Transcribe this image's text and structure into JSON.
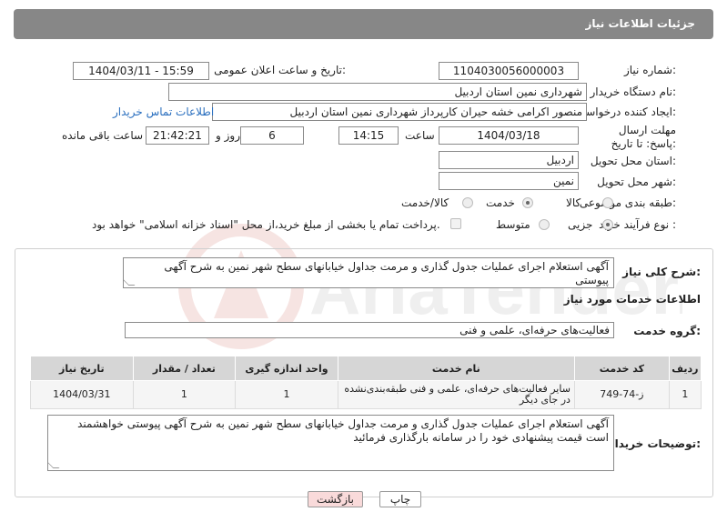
{
  "header": {
    "title": "جزئیات اطلاعات نیاز"
  },
  "labels": {
    "need_number": "شماره نیاز:",
    "announce_datetime": "تاریخ و ساعت اعلان عمومی:",
    "buyer_org": "نام دستگاه خریدار:",
    "requester": "ایجاد کننده درخواست:",
    "deadline": "مهلت ارسال پاسخ: تا تاریخ:",
    "time": "ساعت",
    "days_and": "روز و",
    "time_remaining": "ساعت باقی مانده",
    "province": "استان محل تحویل:",
    "city": "شهر محل تحویل:",
    "category": "طبقه بندی موضوعی:",
    "process_type": "نوع فرآیند خرید :",
    "general_desc": "شرح کلی نیاز:",
    "services_info": "اطلاعات خدمات مورد نیاز",
    "service_group": "گروه خدمت:",
    "buyer_notes": "توضیحات خریدار:"
  },
  "fields": {
    "need_number": "1104030056000003",
    "announce_datetime": "1404/03/11 - 15:59",
    "buyer_org": "شهرداری نمین استان اردبیل",
    "requester": "منصور اکرامی خشه حیران کارپرداز شهرداری نمین استان اردبیل",
    "contact_link": "اطلاعات تماس خریدار",
    "deadline_date": "1404/03/18",
    "deadline_time": "14:15",
    "days": "6",
    "remaining": "21:42:21",
    "province": "اردبیل",
    "city": "نمین"
  },
  "category_options": [
    {
      "label": "کالا",
      "selected": false
    },
    {
      "label": "خدمت",
      "selected": true
    },
    {
      "label": "کالا/خدمت",
      "selected": false
    }
  ],
  "process_options": [
    {
      "label": "جزیی",
      "selected": true
    },
    {
      "label": "متوسط",
      "selected": false
    }
  ],
  "payment_note": "پرداخت تمام یا بخشی از مبلغ خرید،از محل \"اسناد خزانه اسلامی\" خواهد بود.",
  "general_desc": "آگهی استعلام اجرای عملیات جدول گذاری و مرمت جداول خیابانهای سطح شهر نمین به شرح آگهی پیوستی",
  "service_group": "فعالیت‌های حرفه‌ای، علمی و فنی",
  "table": {
    "headers": [
      "ردیف",
      "کد خدمت",
      "نام خدمت",
      "واحد اندازه گیری",
      "تعداد / مقدار",
      "تاریخ نیاز"
    ],
    "rows": [
      [
        "1",
        "ز-74-749",
        "سایر فعالیت‌های حرفه‌ای، علمی و فنی طبقه‌بندی‌نشده در جای دیگر",
        "1",
        "1",
        "1404/03/31"
      ]
    ]
  },
  "buyer_notes": "آگهی استعلام اجرای عملیات جدول گذاری و مرمت جداول خیابانهای سطح شهر نمین به شرح آگهی پیوستی خواهشمند است قیمت پیشنهادی خود را در سامانه بارگذاری فرمائید",
  "buttons": {
    "print": "چاپ",
    "back": "بازگشت"
  },
  "watermark": {
    "text": "AriaTender.neT"
  },
  "colors": {
    "header_bg": "#878787",
    "back_button": "#f9dada",
    "link": "#2a6fbf"
  }
}
